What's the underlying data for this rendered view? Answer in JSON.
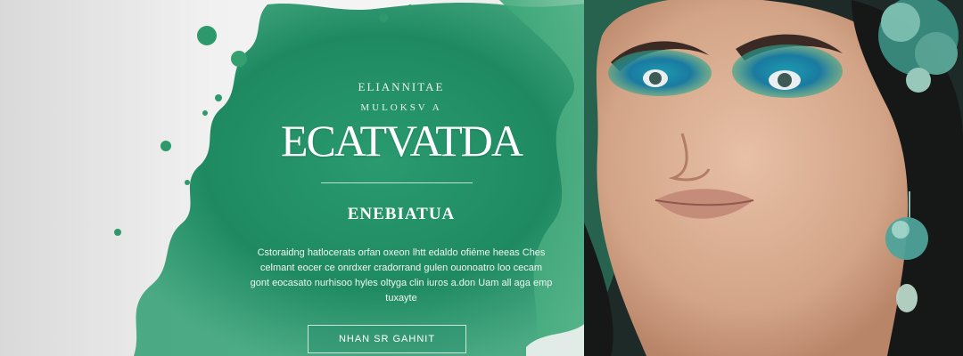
{
  "hero": {
    "kicker_top": "ЕLIANNITAE",
    "kicker_bottom": "MULOKSV A",
    "brand": "ECATVATDA",
    "subtitle": "ENEBIATUA",
    "description": "Cstoraidng hatlocerats orfan oxeon lhtt edaldo ofiéme heeas Ches celmant eocer ce onrdxer cradorrand gulen ouonoatro loo cecam gont eocasato nurhisoo hyles oltyga clin iuros a.don Uam all aga emp tuxayte",
    "cta_label": "NHAN SR GAHNIT"
  },
  "colors": {
    "splash_green": "#2c9a6c",
    "splash_light": "#7cc59e",
    "background": "#eeeeee"
  }
}
